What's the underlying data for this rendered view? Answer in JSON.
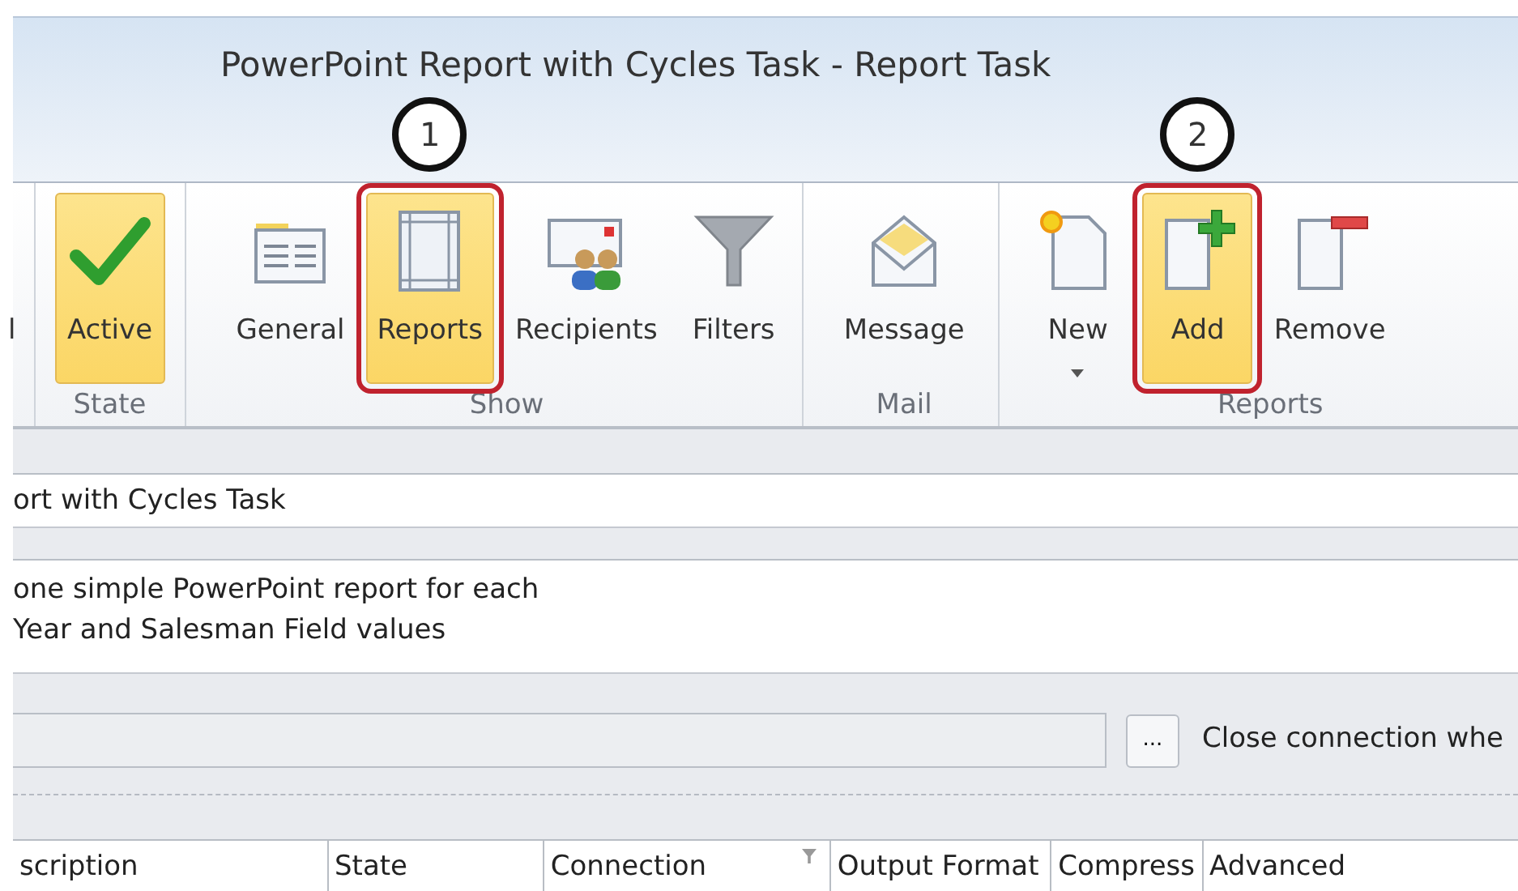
{
  "window": {
    "title": "PowerPoint Report with Cycles Task - Report Task"
  },
  "ribbon": {
    "groups": [
      {
        "buttons": [
          {
            "label": "l",
            "selected": false
          }
        ]
      },
      {
        "label": "State",
        "buttons": [
          {
            "label": "Active",
            "selected": true
          }
        ]
      },
      {
        "label": "Show",
        "buttons": [
          {
            "label": "General",
            "selected": false
          },
          {
            "label": "Reports",
            "selected": true,
            "callout": "1"
          },
          {
            "label": "Recipients",
            "selected": false
          },
          {
            "label": "Filters",
            "selected": false
          }
        ]
      },
      {
        "label": "Mail",
        "buttons": [
          {
            "label": "Message",
            "selected": false
          }
        ]
      },
      {
        "label": "Reports",
        "buttons": [
          {
            "label": "New",
            "selected": false,
            "dropdown": true
          },
          {
            "label": "Add",
            "selected": true,
            "callout": "2"
          },
          {
            "label": "Remove",
            "selected": false
          }
        ]
      }
    ]
  },
  "form": {
    "name": {
      "value": "ort with Cycles Task"
    },
    "description": {
      "lines": [
        "one simple PowerPoint report for each",
        "Year and Salesman Field values"
      ]
    },
    "connection": {
      "browse_button": "...",
      "close_label": "Close connection whe"
    }
  },
  "table": {
    "columns": [
      {
        "label": "scription"
      },
      {
        "label": "State"
      },
      {
        "label": "Connection",
        "filter": true
      },
      {
        "label": "Output Format"
      },
      {
        "label": "Compress"
      },
      {
        "label": "Advanced"
      }
    ]
  }
}
